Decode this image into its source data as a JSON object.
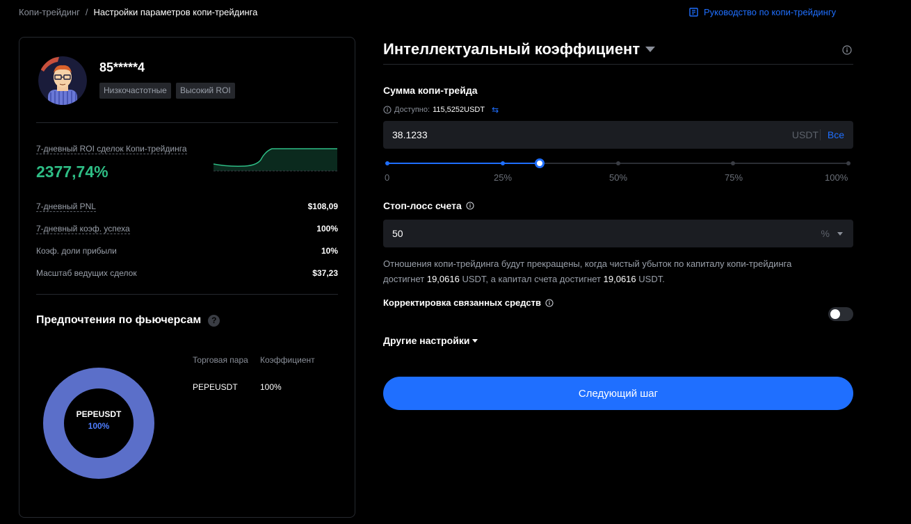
{
  "breadcrumb": {
    "parent": "Копи-трейдинг",
    "separator": "/",
    "current": "Настройки параметров копи-трейдинга"
  },
  "guide_link": "Руководство по копи-трейдингу",
  "trader": {
    "name": "85*****4",
    "tags": [
      "Низкочастотные",
      "Высокий ROI"
    ],
    "roi_label": "7-дневный ROI сделок Копи-трейдинга",
    "roi_value": "2377,74%",
    "stats": [
      {
        "label": "7-дневный PNL",
        "value": "$108,09"
      },
      {
        "label": "7-дневный коэф. успеха",
        "value": "100%"
      },
      {
        "label": "Коэф. доли прибыли",
        "value": "10%"
      },
      {
        "label": "Масштаб ведущих сделок",
        "value": "$37,23"
      }
    ]
  },
  "futures": {
    "title": "Предпочтения по фьючерсам",
    "help": "?",
    "col_pair": "Торговая пара",
    "col_ratio": "Коэффициент",
    "rows": [
      {
        "pair": "PEPEUSDT",
        "ratio": "100%"
      }
    ],
    "donut_pair": "PEPEUSDT",
    "donut_pct": "100%",
    "donut_color": "#5b6fc9"
  },
  "settings": {
    "mode_title": "Интеллектуальный коэффициент",
    "amount_label": "Сумма копи-трейда",
    "available_label": "Доступно:",
    "available_value": "115,5252USDT",
    "amount_value": "38.1233",
    "amount_unit": "USDT",
    "max_label": "Все",
    "slider_percent": 33,
    "slider_marks": [
      "0",
      "25%",
      "50%",
      "75%",
      "100%"
    ],
    "stoploss_label": "Стоп-лосс счета",
    "stoploss_value": "50",
    "stoploss_unit": "%",
    "desc_1": "Отношения копи-трейдинга будут прекращены, когда чистый убыток по капиталу копи-трейдинга",
    "desc_2": "достигнет",
    "desc_amount_1": "19,0616",
    "desc_3": "USDT, а капитал счета достигнет",
    "desc_amount_2": "19,0616",
    "desc_4": "USDT.",
    "adjust_label": "Корректировка связанных средств",
    "adjust_enabled": false,
    "other_label": "Другие настройки",
    "next_button": "Следующий шаг"
  },
  "colors": {
    "accent": "#1f6fff",
    "positive": "#2ebd85",
    "background": "#000000"
  }
}
